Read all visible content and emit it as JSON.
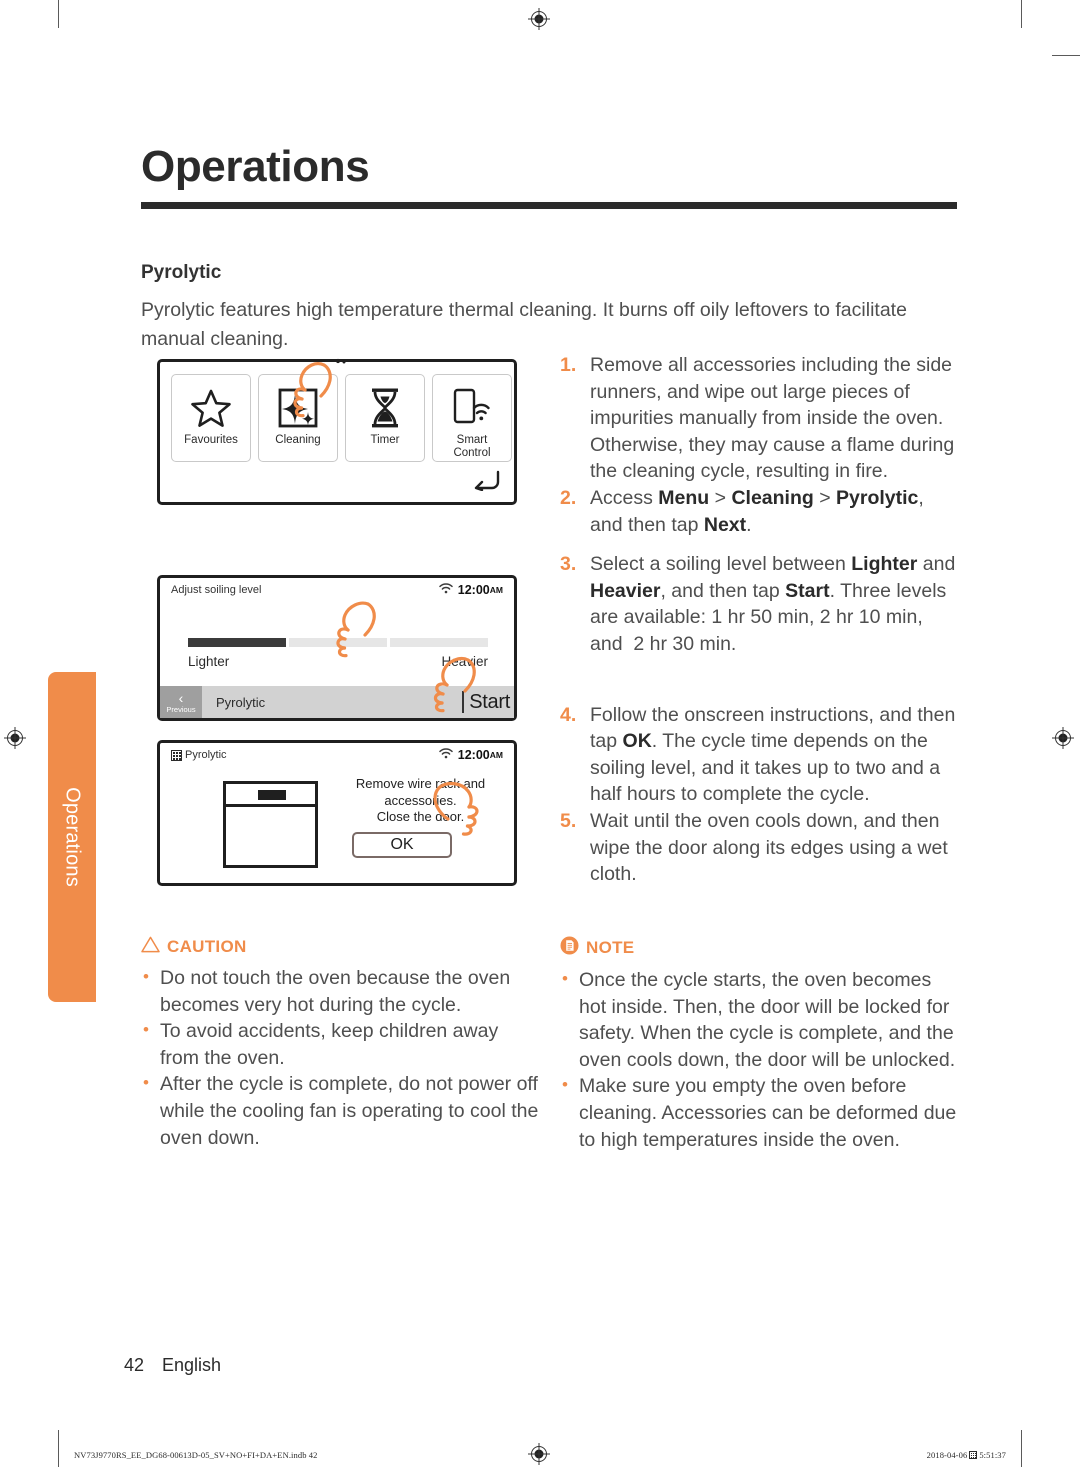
{
  "chapter": {
    "title": "Operations",
    "side_tab_label": "Operations",
    "accent_color": "#f08c4a",
    "rule_color": "#2b2b2b"
  },
  "section": {
    "heading": "Pyrolytic",
    "intro": "Pyrolytic features high temperature thermal cleaning. It burns off oily leftovers to facilitate manual cleaning."
  },
  "panels": {
    "menu": {
      "tiles": [
        {
          "label": "Favourites",
          "icon": "star-icon"
        },
        {
          "label": "Cleaning",
          "icon": "sparkle-square-icon"
        },
        {
          "label": "Timer",
          "icon": "hourglass-icon"
        },
        {
          "label": "Smart Control",
          "label_line1": "Smart",
          "label_line2": "Control",
          "icon": "phone-wifi-icon"
        }
      ],
      "back_icon": "back-arrow-icon",
      "tap_target": "Cleaning"
    },
    "soiling": {
      "status_title": "Adjust soiling level",
      "wifi_icon": "wifi-icon",
      "clock": "12:00",
      "clock_ampm": "AM",
      "slider_segments": 3,
      "slider_active_segments": 1,
      "label_left": "Lighter",
      "label_right": "Heavier",
      "previous_chevron": "chevron-left-icon",
      "previous_label": "Previous",
      "bar_title": "Pyrolytic",
      "start_label": "Start"
    },
    "remove": {
      "status_title": "Pyrolytic",
      "status_icon": "pyrolytic-icon",
      "wifi_icon": "wifi-icon",
      "clock": "12:00",
      "clock_ampm": "AM",
      "oven_icon": "oven-icon",
      "message_line1": "Remove wire rack and",
      "message_line2": "accessories.",
      "message_line3": "Close the door.",
      "ok_label": "OK"
    }
  },
  "steps": [
    {
      "num": "1.",
      "html": "Remove all accessories including the side runners, and wipe out large pieces of impurities manually from inside the oven. Otherwise, they may cause a flame during the cleaning cycle, resulting in fire."
    },
    {
      "num": "2.",
      "html": "Access <b>Menu</b> &gt; <b>Cleaning</b> &gt; <b>Pyrolytic</b>, and then tap <b>Next</b>."
    },
    {
      "num": "3.",
      "html": "Select a soiling level between <b>Lighter</b> and <b>Heavier</b>, and then tap <b>Start</b>. Three levels are available: 1 hr 50 min, 2 hr 10 min, and&nbsp; 2 hr 30 min."
    },
    {
      "num": "4.",
      "html": "Follow the onscreen instructions, and then tap <b>OK</b>. The cycle time depends on the soiling level, and it takes up to two and a half hours to complete the cycle."
    },
    {
      "num": "5.",
      "html": "Wait until the oven cools down, and then wipe the door along its edges using a wet cloth."
    }
  ],
  "caution": {
    "icon": "warning-triangle-icon",
    "title": "CAUTION",
    "bullets": [
      "Do not touch the oven because the oven becomes very hot during the cycle.",
      "To avoid accidents, keep children away from the oven.",
      "After the cycle is complete, do not power off while the cooling fan is operating to cool the oven down."
    ]
  },
  "note": {
    "icon": "note-document-icon",
    "title": "NOTE",
    "bullets": [
      "Once the cycle starts, the oven becomes hot inside. Then, the door will be locked for safety. When the cycle is complete, and the oven cools down, the door will be unlocked.",
      "Make sure you empty the oven before cleaning. Accessories can be deformed due to high temperatures inside the oven."
    ]
  },
  "footer": {
    "page_number": "42",
    "language": "English",
    "print_left": "NV73J9770RS_EE_DG68-00613D-05_SV+NO+FI+DA+EN.indb   42",
    "print_date": "2018-04-06",
    "print_time": "5:51:37"
  }
}
